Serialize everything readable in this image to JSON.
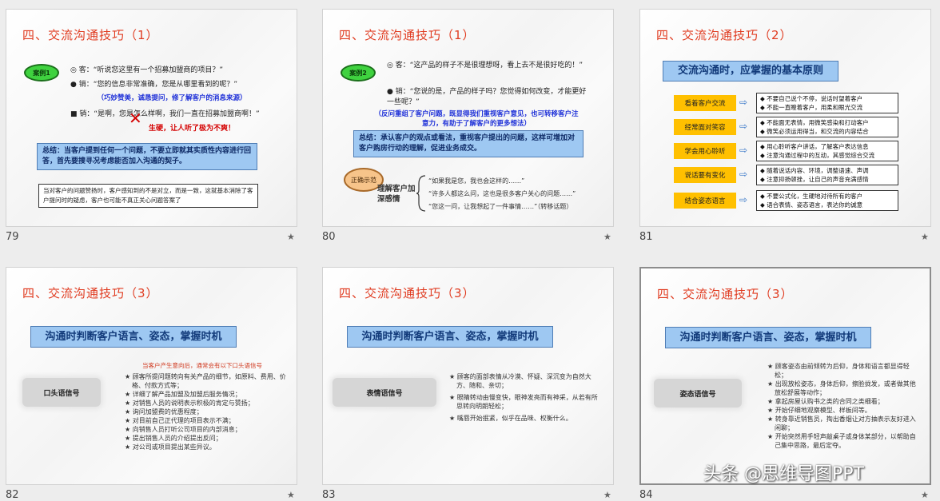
{
  "slides": [
    {
      "number": "79",
      "title": "四、交流沟通技巧（1）",
      "case_label": "案例1",
      "line1": "◎ 客：“听说您这里有一个招募加盟商的项目？”",
      "line2": "● 销：“您的信息非常准确，您是从哪里看到的呢？”",
      "note1": "（巧妙赞美，诚恳提问，修了解客户的消息来源）",
      "line3": "■ 销：“是啊，您是怎么样啊，我们一直在招募加盟商啊！”",
      "wrong_mark": "✕",
      "red_note": "生硬，让人听了极为不爽！",
      "summary": "总结：当客户提到任何一个问题，不要立即就其实质性内容进行回答，首先要搜寻况考虑能否加入沟通的契子。",
      "bottom": "当对客户的问题赞扬时，客户感知到的不是对立，而是一致，这就基本消除了客户提问时的疑虑，客户也可能不真正关心问题答案了"
    },
    {
      "number": "80",
      "title": "四、交流沟通技巧（1）",
      "case_label": "案例2",
      "line1": "◎ 客：“这产品的样子不是很理想呀，看上去不是很好吃的！”",
      "line2": "● 销：“您说的是，产品的样子吗？您觉得如何改变，才能更好一些呢？”",
      "note1": "（反问重组了客户问题，既显得我们重视客户意见，也可转移客户注意力，有助于了解客户的更多想法）",
      "summary": "总结：承认客户的观点或看法，重视客户提出的问题，这样可增加对客户购房行动的理解，促进业务成交。",
      "cloud2": "正确示范",
      "understand": "理解客户加深感情",
      "examples": [
        "“如果我是您，我也会这样的……”",
        "“许多人都这么问，这也是很多客户关心的问题……”",
        "“您这一问，让我想起了一件事情……”（转移话题）"
      ]
    },
    {
      "number": "81",
      "title": "四、交流沟通技巧（2）",
      "header": "交流沟通时，应掌握的基本原则",
      "principles": [
        {
          "label": "看着客户交流",
          "a": "◆ 不要自己说个不停，说话时望着客户",
          "b": "◆ 不能一直瞪着客户，用柔和眼光交流"
        },
        {
          "label": "经常面对笑容",
          "a": "◆ 不能面无表情，用微笑感染和打动客户",
          "b": "◆ 微笑必须运用得当，和交流的内容结合"
        },
        {
          "label": "学会用心聆听",
          "a": "◆ 用心聆听客户讲话，了解客户表达信息",
          "b": "◆ 注意沟通过程中的互动，其感觉综合交流"
        },
        {
          "label": "说话要有变化",
          "a": "◆ 随着说话内容、环境，调整语速、声调",
          "b": "◆ 注意抑扬顿挫，让自己的声音充满感情"
        },
        {
          "label": "结合姿态语言",
          "a": "◆ 不要公式化，生硬地对待所有的客户",
          "b": "◆ 语合表情、姿态语言，表达你的诚意"
        }
      ]
    },
    {
      "number": "82",
      "title": "四、交流沟通技巧（3）",
      "header": "沟通时判断客户语言、姿态，掌握时机",
      "box_label": "口头语信号",
      "orange_head": "当客户产生意向后，通常会有以下口头语信号",
      "bullets": [
        "★ 顾客所提问题转向有关产品的细节，如原料、费用、价格、付款方式等；",
        "★ 详细了解产品加盟及加盟后服务情况；",
        "★ 对销售人员的说明表示积极的肯定与赞扬；",
        "★ 询问加盟费的优惠程度；",
        "★ 对目前自己正代理的项目表示不满；",
        "★ 向销售人员打听公司项目的内部消息；",
        "★ 提出销售人员的介绍提出反问；",
        "★ 对公司或项目提出某些异议。"
      ]
    },
    {
      "number": "83",
      "title": "四、交流沟通技巧（3）",
      "header": "沟通时判断客户语言、姿态，掌握时机",
      "box_label": "表情语信号",
      "bullets": [
        "★ 顾客的面部表情从冷漠、怀疑、深沉变为自然大方、随和、亲切；",
        "★ 眼睛转动由慢变快，眼神发亮而有神采，从若有所思转向明朗轻松；",
        "★ 嘴唇开始抿紧，似乎在品味、权衡什么。"
      ]
    },
    {
      "number": "84",
      "title": "四、交流沟通技巧（3）",
      "header": "沟通时判断客户语言、姿态，掌握时机",
      "box_label": "姿态语信号",
      "bullets": [
        "★ 顾客姿态由前倾转为后仰，身体和语言都显得轻松；",
        "★ 出现放松姿态，身体后仰，擦脸拢发，或者做其他放松舒展等动作；",
        "★ 拿起房屋认购书之类的合同之类细看；",
        "★ 开始仔细地观察模型、样板间等。",
        "★ 转身靠近销售员，掏出香烟让对方抽表示友好进入闲聊；",
        "★ 开始突然用手轻声敲桌子或身体某部分，以帮助自己集中思路，最后定夺。"
      ]
    }
  ],
  "watermark": "头条 @思维导图PPT"
}
